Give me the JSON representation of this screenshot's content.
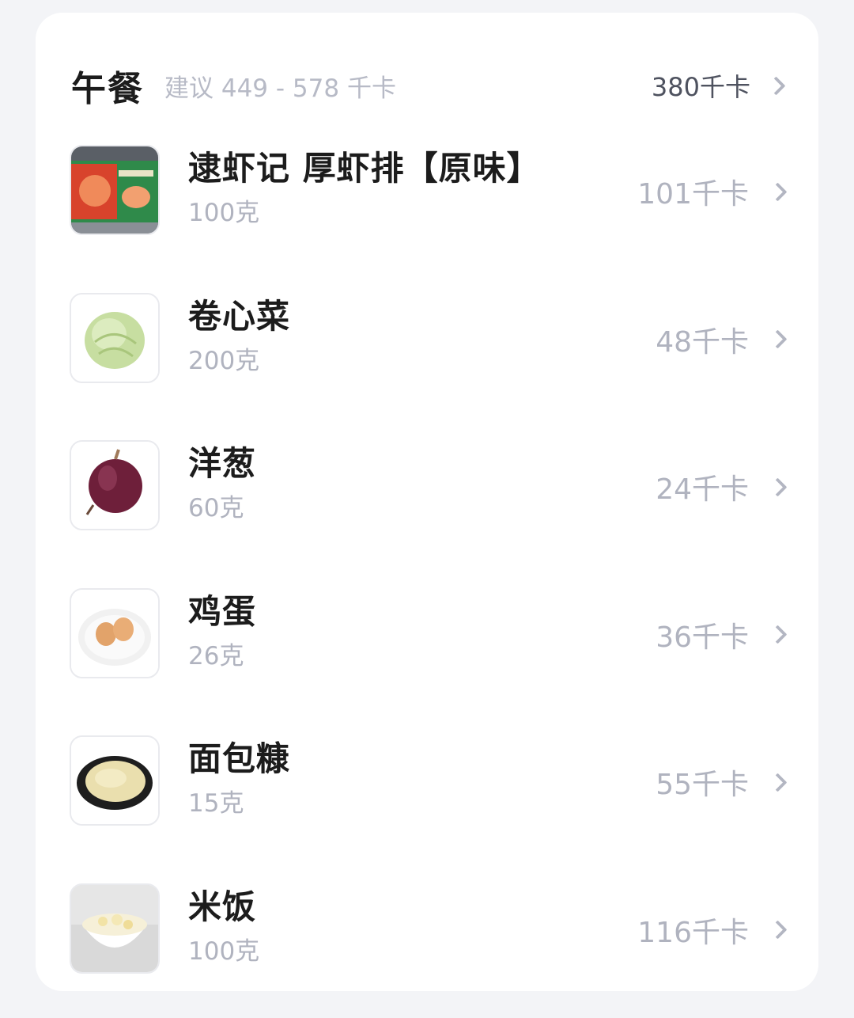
{
  "meal": {
    "title": "午餐",
    "suggestion": "建议 449 - 578 千卡",
    "total": "380千卡"
  },
  "items": [
    {
      "name": "逮虾记 厚虾排【原味】",
      "qty": "100克",
      "kcal": "101千卡",
      "icon": "shrimp-patty-package"
    },
    {
      "name": "卷心菜",
      "qty": "200克",
      "kcal": "48千卡",
      "icon": "cabbage"
    },
    {
      "name": "洋葱",
      "qty": "60克",
      "kcal": "24千卡",
      "icon": "red-onion"
    },
    {
      "name": "鸡蛋",
      "qty": "26克",
      "kcal": "36千卡",
      "icon": "eggs-on-plate"
    },
    {
      "name": "面包糠",
      "qty": "15克",
      "kcal": "55千卡",
      "icon": "breadcrumbs-plate"
    },
    {
      "name": "米饭",
      "qty": "100克",
      "kcal": "116千卡",
      "icon": "rice-bowl"
    }
  ],
  "colors": {
    "background": "#f3f4f7",
    "card": "#ffffff",
    "title": "#1c1c1c",
    "muted": "#b0b3bf"
  }
}
